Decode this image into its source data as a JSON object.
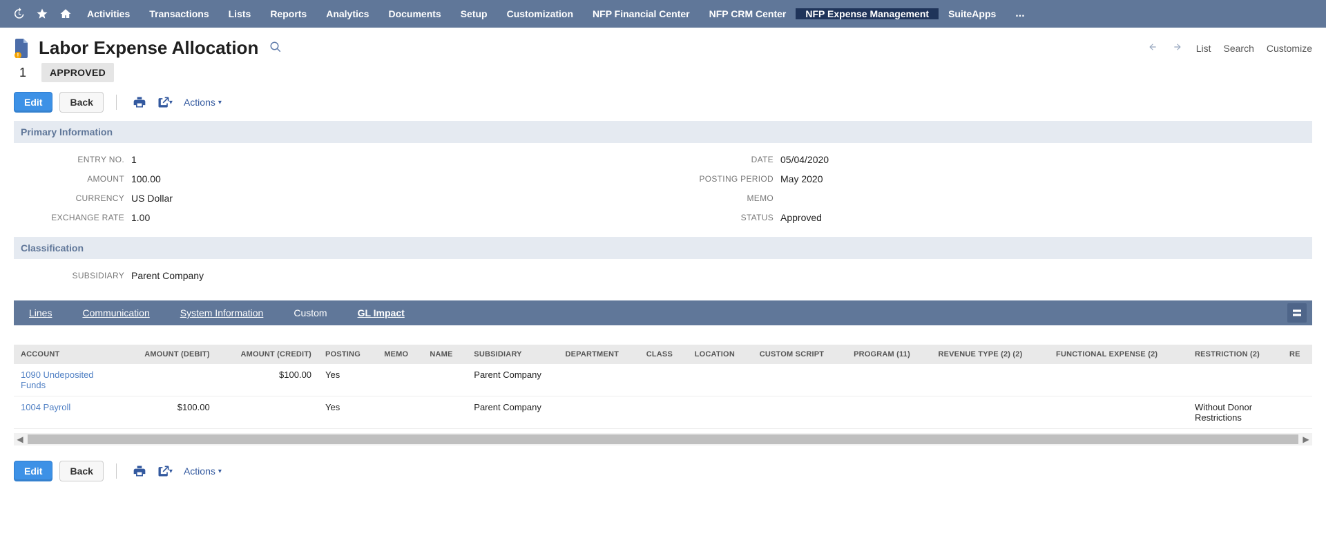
{
  "nav": {
    "items": [
      "Activities",
      "Transactions",
      "Lists",
      "Reports",
      "Analytics",
      "Documents",
      "Setup",
      "Customization",
      "NFP Financial Center",
      "NFP CRM Center",
      "NFP Expense Management",
      "SuiteApps"
    ],
    "active": "NFP Expense Management",
    "ellipsis": "..."
  },
  "header": {
    "title": "Labor Expense Allocation",
    "rightLinks": {
      "list": "List",
      "search": "Search",
      "customize": "Customize"
    }
  },
  "status": {
    "number": "1",
    "badge": "APPROVED"
  },
  "buttons": {
    "edit": "Edit",
    "back": "Back",
    "actions": "Actions"
  },
  "sections": {
    "primary": "Primary Information",
    "classification": "Classification"
  },
  "primary": {
    "leftLabels": {
      "entryNo": "ENTRY NO.",
      "amount": "AMOUNT",
      "currency": "CURRENCY",
      "exchangeRate": "EXCHANGE RATE"
    },
    "left": {
      "entryNo": "1",
      "amount": "100.00",
      "currency": "US Dollar",
      "exchangeRate": "1.00"
    },
    "rightLabels": {
      "date": "DATE",
      "postingPeriod": "POSTING PERIOD",
      "memo": "MEMO",
      "status": "STATUS"
    },
    "right": {
      "date": "05/04/2020",
      "postingPeriod": "May 2020",
      "memo": "",
      "status": "Approved"
    }
  },
  "classification": {
    "labels": {
      "subsidiary": "SUBSIDIARY"
    },
    "subsidiary": "Parent Company"
  },
  "tabs": {
    "items": [
      "Lines",
      "Communication",
      "System Information",
      "Custom",
      "GL Impact"
    ],
    "active": "GL Impact",
    "underlined": [
      "Lines",
      "Communication",
      "System Information"
    ]
  },
  "table": {
    "headers": {
      "account": "ACCOUNT",
      "amountDebit": "AMOUNT (DEBIT)",
      "amountCredit": "AMOUNT (CREDIT)",
      "posting": "POSTING",
      "memo": "MEMO",
      "name": "NAME",
      "subsidiary": "SUBSIDIARY",
      "department": "DEPARTMENT",
      "class": "CLASS",
      "location": "LOCATION",
      "customScript": "CUSTOM SCRIPT",
      "program": "PROGRAM (11)",
      "revenueType": "REVENUE TYPE (2) (2)",
      "functionalExpense": "FUNCTIONAL EXPENSE (2)",
      "restriction": "RESTRICTION (2)",
      "re": "RE"
    },
    "rows": [
      {
        "account": "1090 Undeposited Funds",
        "amountDebit": "",
        "amountCredit": "$100.00",
        "posting": "Yes",
        "memo": "",
        "name": "",
        "subsidiary": "Parent Company",
        "department": "",
        "class": "",
        "location": "",
        "customScript": "",
        "program": "",
        "revenueType": "",
        "functionalExpense": "",
        "restriction": ""
      },
      {
        "account": "1004 Payroll",
        "amountDebit": "$100.00",
        "amountCredit": "",
        "posting": "Yes",
        "memo": "",
        "name": "",
        "subsidiary": "Parent Company",
        "department": "",
        "class": "",
        "location": "",
        "customScript": "",
        "program": "",
        "revenueType": "",
        "functionalExpense": "",
        "restriction": "Without Donor Restrictions"
      }
    ]
  }
}
